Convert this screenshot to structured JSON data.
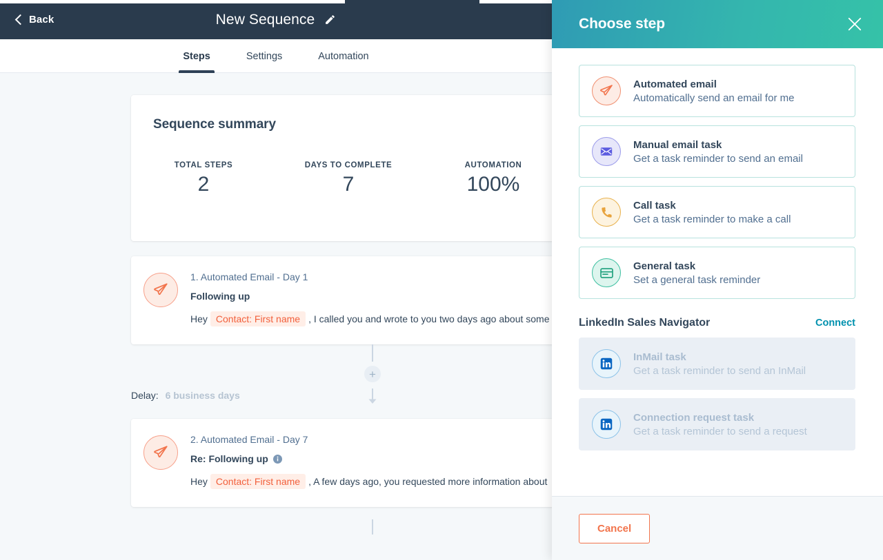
{
  "topbar": {
    "back_label": "Back",
    "sequence_title": "New Sequence",
    "edit_icon": "pencil-icon"
  },
  "tabs": [
    {
      "label": "Steps",
      "active": true
    },
    {
      "label": "Settings",
      "active": false
    },
    {
      "label": "Automation",
      "active": false
    }
  ],
  "summary": {
    "title": "Sequence summary",
    "stats": [
      {
        "label": "TOTAL STEPS",
        "value": "2"
      },
      {
        "label": "DAYS TO COMPLETE",
        "value": "7"
      },
      {
        "label": "AUTOMATION",
        "value": "100%"
      }
    ]
  },
  "steps": [
    {
      "icon": "paper-plane-icon",
      "eyebrow": "1. Automated Email - Day 1",
      "subject": "Following up",
      "has_info_icon": false,
      "preview_before": "Hey",
      "preview_token": "Contact: First name",
      "preview_after": ", I called you and wrote to you two days ago about some"
    },
    {
      "icon": "paper-plane-icon",
      "eyebrow": "2. Automated Email - Day 7",
      "subject": "Re: Following up",
      "has_info_icon": true,
      "preview_before": "Hey",
      "preview_token": "Contact: First name",
      "preview_after": ", A few days ago, you requested more information about"
    }
  ],
  "connector": {
    "add_label": "+",
    "delay_label": "Delay:",
    "delay_value": "6 business days"
  },
  "panel": {
    "title": "Choose step",
    "close_icon": "close-icon",
    "options": [
      {
        "icon": "paper-plane-icon",
        "title": "Automated email",
        "desc": "Automatically send an email for me",
        "disabled": false
      },
      {
        "icon": "envelope-icon",
        "title": "Manual email task",
        "desc": "Get a task reminder to send an email",
        "disabled": false
      },
      {
        "icon": "phone-icon",
        "title": "Call task",
        "desc": "Get a task reminder to make a call",
        "disabled": false
      },
      {
        "icon": "task-card-icon",
        "title": "General task",
        "desc": "Set a general task reminder",
        "disabled": false
      }
    ],
    "linkedin": {
      "section_title": "LinkedIn Sales Navigator",
      "connect_label": "Connect",
      "options": [
        {
          "icon": "linkedin-icon",
          "title": "InMail task",
          "desc": "Get a task reminder to send an InMail",
          "disabled": true
        },
        {
          "icon": "linkedin-icon",
          "title": "Connection request task",
          "desc": "Get a task reminder to send a request",
          "disabled": true
        }
      ]
    },
    "footer": {
      "cancel_label": "Cancel"
    }
  },
  "colors": {
    "header_dark": "#2a3b4d",
    "teal_start": "#2f9bb4",
    "teal_end": "#35c2a8",
    "orange": "#f2744c",
    "link_teal": "#0091ae",
    "text": "#33475b",
    "bg": "#f5f8fa"
  }
}
